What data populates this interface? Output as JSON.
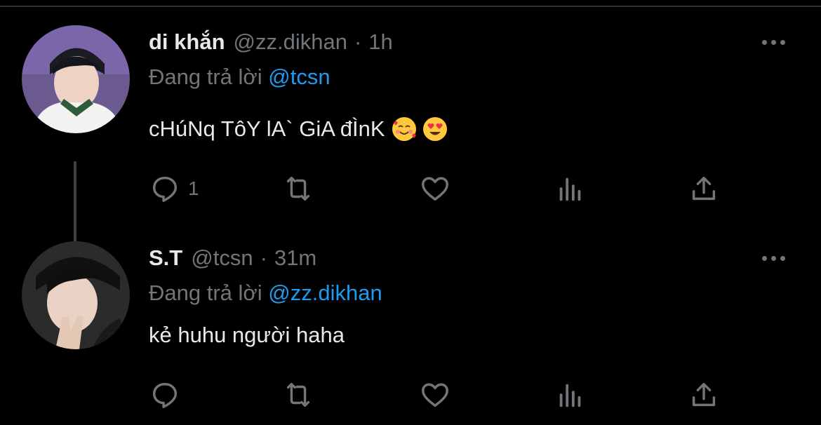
{
  "colors": {
    "background": "#000000",
    "text": "#e7e9ea",
    "muted": "#71767b",
    "link": "#1d9bf0",
    "thread_line": "#3d4145"
  },
  "tweets": [
    {
      "name": "di khắn",
      "handle": "@zz.dikhan",
      "separator": "·",
      "time": "1h",
      "replying_prefix": "Đang trả lời",
      "replying_to": "@tcsn",
      "text": "cHúNq TôY lA` GiA đÌnK",
      "emojis": [
        "smiling-face-with-hearts",
        "heart-eyes"
      ],
      "reply_count": "1"
    },
    {
      "name": "S.T",
      "handle": "@tcsn",
      "separator": "·",
      "time": "31m",
      "replying_prefix": "Đang trả lời",
      "replying_to": "@zz.dikhan",
      "text": "kẻ huhu người haha",
      "emojis": [],
      "reply_count": ""
    }
  ],
  "icons": [
    "reply-icon",
    "retweet-icon",
    "like-icon",
    "views-icon",
    "share-icon",
    "more-icon"
  ]
}
